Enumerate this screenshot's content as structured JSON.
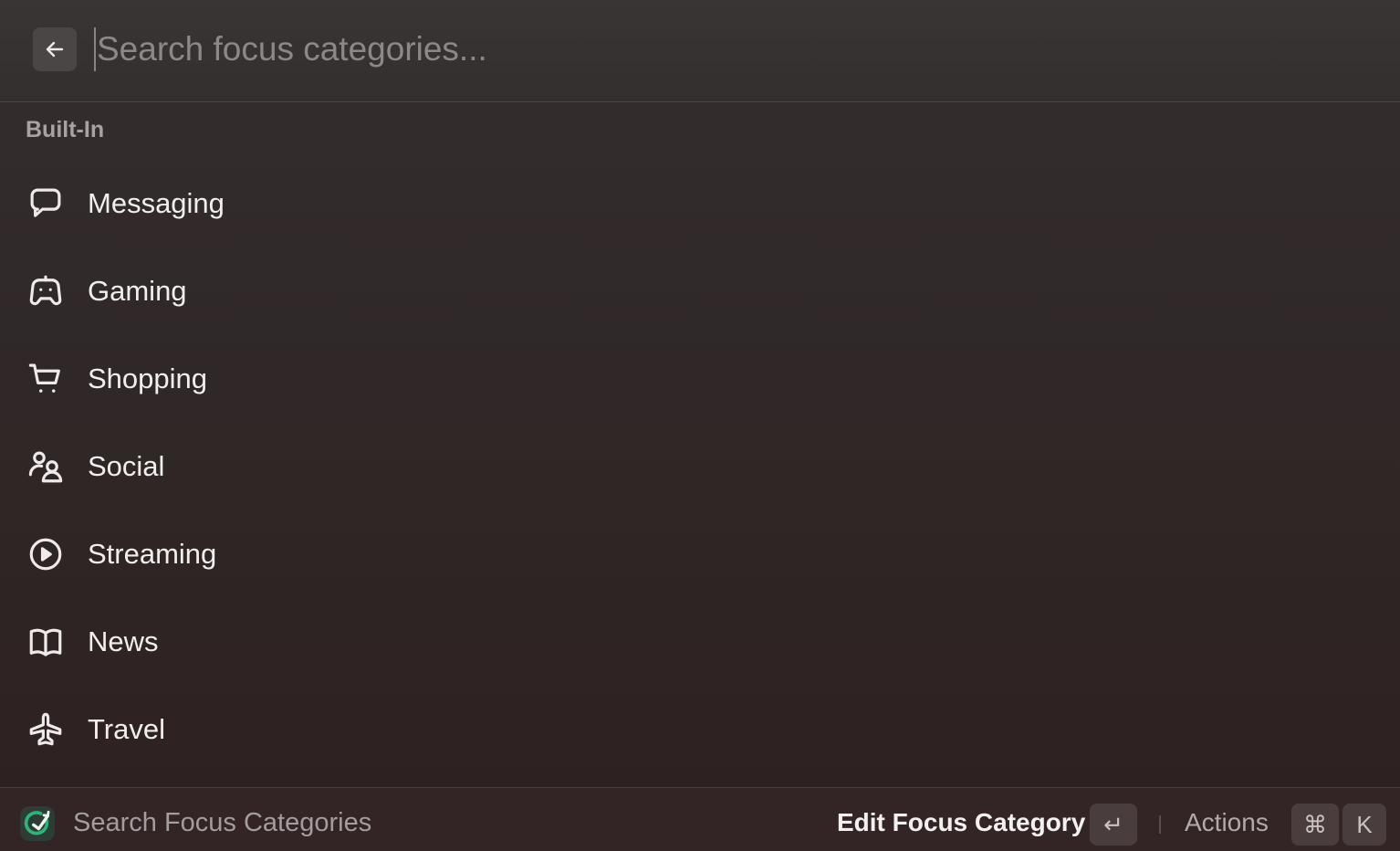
{
  "search": {
    "placeholder": "Search focus categories...",
    "value": ""
  },
  "section": {
    "title": "Built-In"
  },
  "items": [
    {
      "label": "Messaging",
      "icon": "message-bubble-icon"
    },
    {
      "label": "Gaming",
      "icon": "gamepad-icon"
    },
    {
      "label": "Shopping",
      "icon": "cart-icon"
    },
    {
      "label": "Social",
      "icon": "people-icon"
    },
    {
      "label": "Streaming",
      "icon": "play-circle-icon"
    },
    {
      "label": "News",
      "icon": "book-icon"
    },
    {
      "label": "Travel",
      "icon": "airplane-icon"
    }
  ],
  "footer": {
    "title": "Search Focus Categories",
    "primary_action": "Edit Focus Category",
    "enter_key": "↵",
    "actions_label": "Actions",
    "cmd_key": "⌘",
    "k_key": "K"
  },
  "colors": {
    "accent": "#2fb37a",
    "background": "#302828"
  }
}
